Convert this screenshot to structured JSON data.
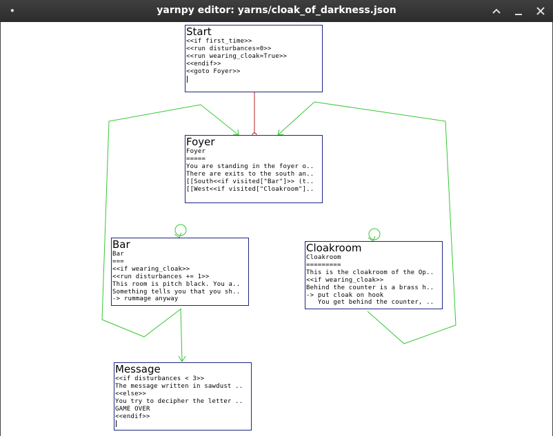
{
  "window": {
    "title": "yarnpy editor: yarns/cloak_of_darkness.json",
    "menu_glyph": "•",
    "minimize_glyph": "—",
    "maximize_glyph": "^",
    "close_glyph": "✕"
  },
  "nodes": {
    "start": {
      "title": "Start",
      "lines": [
        "<<if first_time>>",
        "<<run disturbances=0>>",
        "<<run wearing_cloak=True>>",
        "<<endif>>",
        "<<goto Foyer>>"
      ]
    },
    "foyer": {
      "title": "Foyer",
      "lines": [
        "Foyer",
        "=====",
        "You are standing in the foyer o..",
        "There are exits to the south an..",
        "[[South<<if visited[\"Bar\"]>> (t..",
        "[[West<<if visited[\"Cloakroom\"].."
      ]
    },
    "bar": {
      "title": "Bar",
      "lines": [
        "Bar",
        "===",
        "<<if wearing_cloak>>",
        "<<run disturbances += 1>>",
        "This room is pitch black. You a..",
        "Something tells you that you sh..",
        "-> rummage anyway"
      ]
    },
    "cloakroom": {
      "title": "Cloakroom",
      "lines": [
        "Cloakroom",
        "=========",
        "This is the cloakroom of the Op..",
        "<<if wearing_cloak>>",
        "Behind the counter is a brass h..",
        "-> put cloak on hook",
        "   You get behind the counter, .."
      ]
    },
    "message": {
      "title": "Message",
      "lines": [
        "<<if disturbances < 3>>",
        "The message written in sawdust ..",
        "<<else>>",
        "You try to decipher the letter ..",
        "GAME OVER",
        "<<endif>>"
      ]
    }
  },
  "colors": {
    "node_border": "#1a237e",
    "link_green": "#33c633",
    "link_red": "#b22222"
  }
}
